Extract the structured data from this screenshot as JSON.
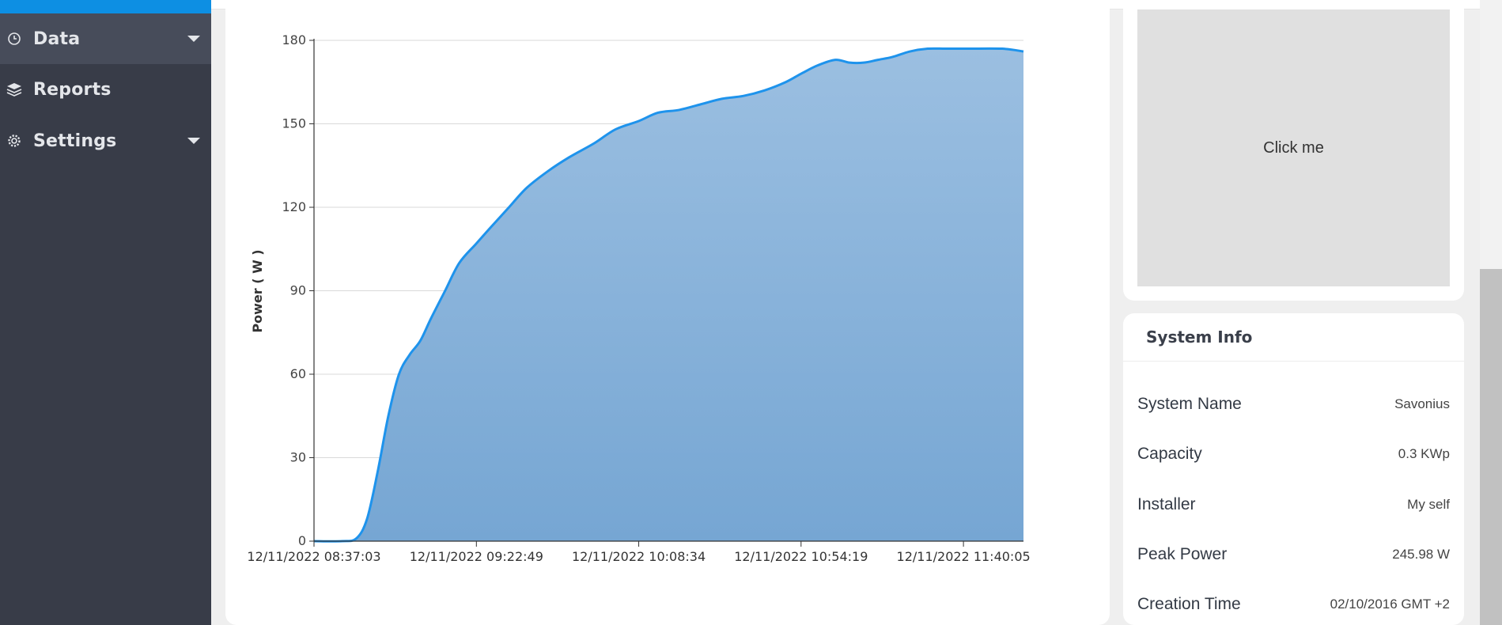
{
  "sidebar": {
    "items": [
      {
        "label": "Data",
        "icon": "clock-icon",
        "has_caret": true,
        "active": true
      },
      {
        "label": "Reports",
        "icon": "layers-icon",
        "has_caret": false,
        "active": false
      },
      {
        "label": "Settings",
        "icon": "gear-icon",
        "has_caret": true,
        "active": false
      }
    ]
  },
  "click_card": {
    "button_label": "Click me"
  },
  "system_info": {
    "title": "System Info",
    "rows": [
      {
        "label": "System Name",
        "value": "Savonius"
      },
      {
        "label": "Capacity",
        "value": "0.3 KWp"
      },
      {
        "label": "Installer",
        "value": "My self"
      },
      {
        "label": "Peak Power",
        "value": "245.98 W"
      },
      {
        "label": "Creation Time",
        "value": "02/10/2016 GMT +2"
      }
    ]
  },
  "colors": {
    "accent": "#0d8fe3",
    "sidebar_bg": "#383c48",
    "line": "#1e93ec",
    "area_top": "#9bbfe1",
    "area_bottom": "#76a6d3"
  },
  "chart_data": {
    "type": "area",
    "ylabel": "Power ( W )",
    "xlabel": "",
    "ylim": [
      0,
      180
    ],
    "yticks": [
      0,
      30,
      60,
      90,
      120,
      150,
      180
    ],
    "xticks": [
      "12/11/2022 08:37:03",
      "12/11/2022 09:22:49",
      "12/11/2022 10:08:34",
      "12/11/2022 10:54:19",
      "12/11/2022 11:40:05"
    ],
    "grid": true,
    "series": [
      {
        "x": [
          "12/11/2022 08:37:03",
          "12/11/2022 08:45:00",
          "12/11/2022 08:49:00",
          "12/11/2022 08:52:00",
          "12/11/2022 08:55:00",
          "12/11/2022 08:58:00",
          "12/11/2022 09:01:00",
          "12/11/2022 09:04:00",
          "12/11/2022 09:07:00",
          "12/11/2022 09:10:00",
          "12/11/2022 09:14:00",
          "12/11/2022 09:18:00",
          "12/11/2022 09:22:49",
          "12/11/2022 09:27:00",
          "12/11/2022 09:32:00",
          "12/11/2022 09:37:00",
          "12/11/2022 09:43:00",
          "12/11/2022 09:49:00",
          "12/11/2022 09:56:00",
          "12/11/2022 10:02:00",
          "12/11/2022 10:08:34",
          "12/11/2022 10:14:00",
          "12/11/2022 10:20:00",
          "12/11/2022 10:26:00",
          "12/11/2022 10:32:00",
          "12/11/2022 10:38:00",
          "12/11/2022 10:44:00",
          "12/11/2022 10:50:00",
          "12/11/2022 10:54:19",
          "12/11/2022 10:59:00",
          "12/11/2022 11:04:00",
          "12/11/2022 11:08:00",
          "12/11/2022 11:12:00",
          "12/11/2022 11:16:00",
          "12/11/2022 11:20:00",
          "12/11/2022 11:25:00",
          "12/11/2022 11:30:00",
          "12/11/2022 11:35:00",
          "12/11/2022 11:40:05",
          "12/11/2022 11:51:00",
          "12/11/2022 11:57:00"
        ],
        "y": [
          0,
          0,
          1,
          8,
          25,
          45,
          60,
          67,
          72,
          80,
          90,
          100,
          107,
          113,
          120,
          127,
          133,
          138,
          143,
          148,
          151,
          154,
          155,
          157,
          159,
          160,
          162,
          165,
          168,
          171,
          173,
          172,
          172,
          173,
          174,
          176,
          177,
          177,
          177,
          177,
          176
        ]
      }
    ]
  }
}
